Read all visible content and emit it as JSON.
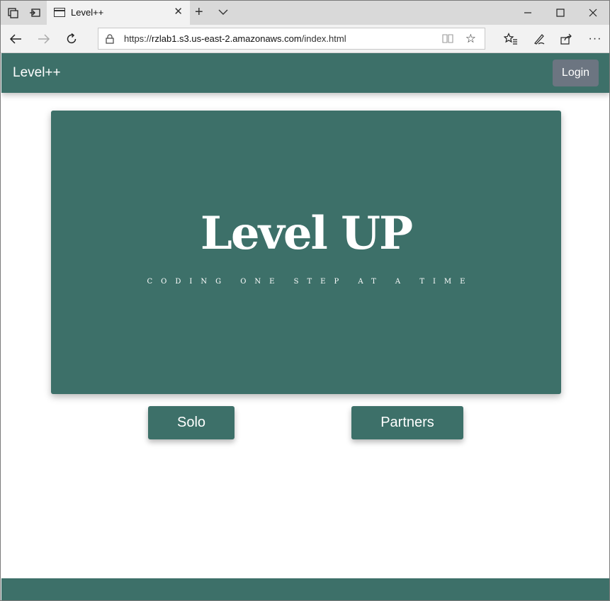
{
  "browser": {
    "tab_title": "Level++",
    "url_prefix": "https://",
    "url_host": "rzlab1.s3.us-east-2.amazonaws.com",
    "url_path": "/index.html"
  },
  "site": {
    "brand": "Level++",
    "login_label": "Login"
  },
  "hero": {
    "title": "Level UP",
    "subtitle": "CODING ONE STEP AT A TIME"
  },
  "actions": {
    "solo_label": "Solo",
    "partners_label": "Partners"
  },
  "colors": {
    "primary": "#3d7069",
    "login": "#6c7581"
  }
}
